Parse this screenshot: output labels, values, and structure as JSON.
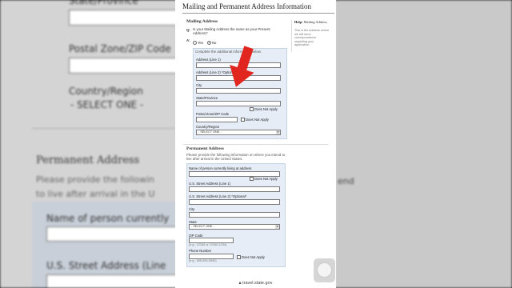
{
  "background": {
    "left_labels": {
      "state": "State/Province",
      "zip": "Postal Zone/ZIP Code",
      "country": "Country/Region",
      "country_select": "- SELECT ONE -",
      "permanent": "Permanent Address",
      "please_1": "Please provide the followin",
      "please_2": "to live after arrival in the U",
      "name": "Name of person currently",
      "street": "U.S. Street Address (Line"
    },
    "right_labels": {
      "end": "end"
    }
  },
  "page": {
    "title": "Mailing and Permanent Address Information"
  },
  "mailing": {
    "heading": "Mailing Address",
    "q_prefix": "Q:",
    "question": "Is your Mailing Address the same as your Present Address?",
    "a_prefix": "A:",
    "yes": "Yes",
    "no": "No",
    "complete_text": "Complete the additional information below.",
    "addr1": "Address (Line 1)",
    "addr2": "Address (Line 2) *Optional*",
    "city": "City",
    "state": "State/Province",
    "does_not_apply": "Does Not Apply",
    "zip": "Postal Zone/ZIP Code",
    "country": "Country/Region",
    "country_select": "- SELECT ONE -"
  },
  "help": {
    "title_bold": "Help:",
    "title": "Mailing Address",
    "text": "This is the address where we will send correspondence regarding your application."
  },
  "permanent": {
    "heading": "Permanent Address",
    "intro": "Please provide the following information on where you intend to live after arrival in the United States.",
    "name": "Name of person currently living at address",
    "does_not_apply": "Does Not Apply",
    "street1": "U.S. Street Address (Line 1)",
    "street2": "U.S. Street Address (Line 2) *Optional*",
    "city": "City",
    "state": "State",
    "state_select": "- SELECT ONE -",
    "zip": "ZIP Code",
    "zip_hint": "(e.g., 12345 or 12345-1234)",
    "phone": "Phone Number",
    "phone_hint": "(e.g., 555-555-5555)",
    "phone_dna": "Does Not Apply"
  },
  "browser": {
    "url": "travel.state.gov"
  },
  "colors": {
    "arrow": "#e0261f",
    "group_bg": "#e6edf6"
  }
}
